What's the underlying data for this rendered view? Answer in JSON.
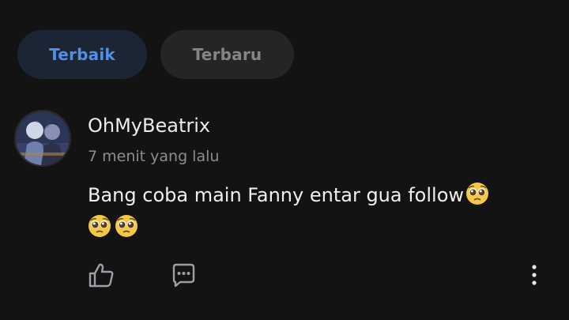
{
  "tabs": {
    "best_label": "Terbaik",
    "newest_label": "Terbaru"
  },
  "comment": {
    "username": "OhMyBeatrix",
    "timestamp": "7 menit yang lalu",
    "text": "Bang coba main Fanny entar gua follow",
    "emoji_name": "pleading-face-emoji",
    "emoji_count": 3
  },
  "actions": {
    "like_icon": "thumbs-up-icon",
    "reply_icon": "chat-bubble-dots-icon",
    "more_icon": "vertical-ellipsis-icon"
  },
  "colors": {
    "background": "#131313",
    "tab_active_bg": "#1c2533",
    "tab_active_text": "#4d90ea",
    "tab_inactive_bg": "#252525",
    "tab_inactive_text": "#858585",
    "username": "#ececec",
    "timestamp": "#8d8d8d",
    "icon": "#9aa0a6"
  }
}
